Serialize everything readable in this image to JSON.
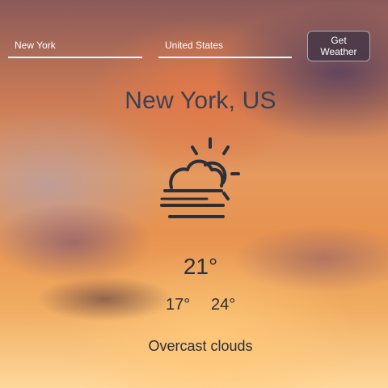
{
  "search": {
    "city_value": "New York",
    "country_value": "United States",
    "button_label": "Get Weather"
  },
  "weather": {
    "location": "New York, US",
    "icon": "partly-cloudy-fog-icon",
    "temperature": "21°",
    "temp_min": "17°",
    "temp_max": "24°",
    "description": "Overcast clouds"
  },
  "colors": {
    "text_dark": "#2b2f39",
    "button_bg": "#46374680",
    "input_underline": "#ffffff"
  }
}
